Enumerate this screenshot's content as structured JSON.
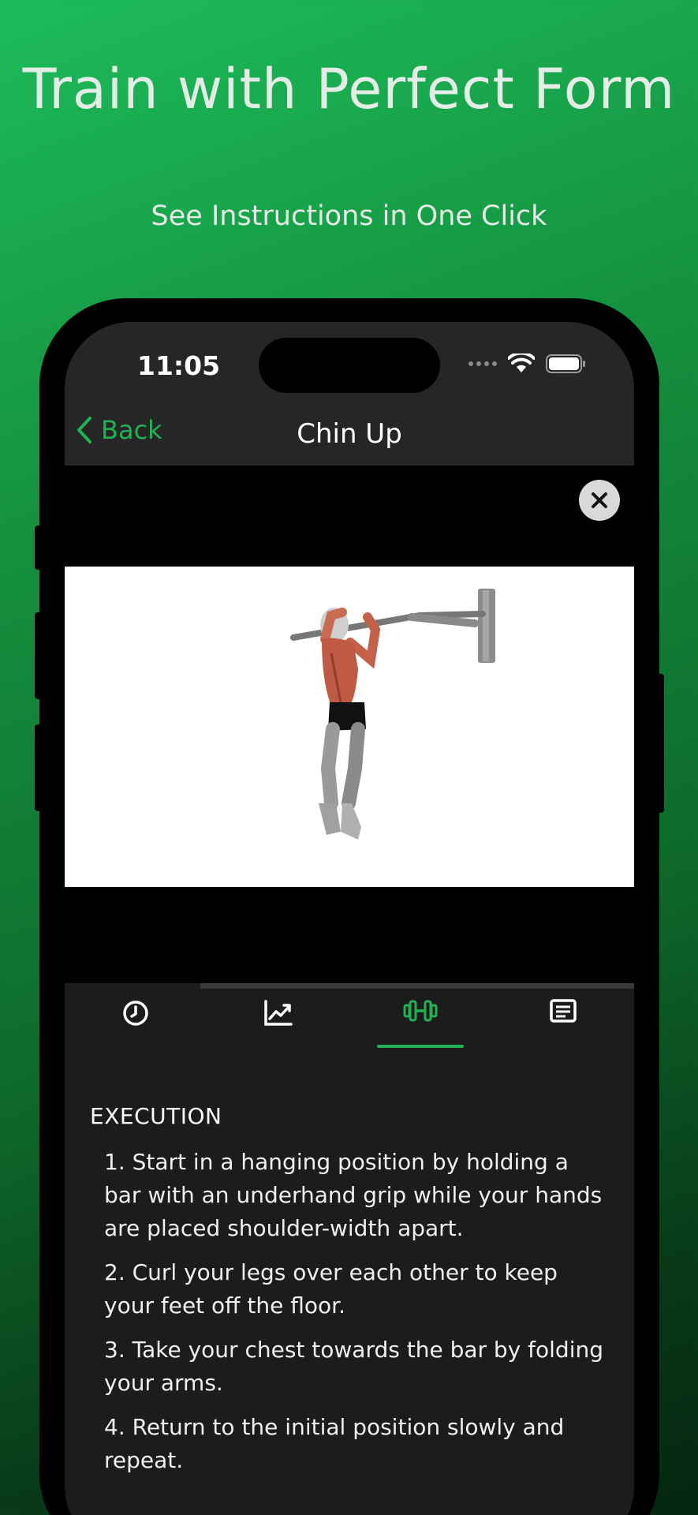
{
  "promo": {
    "headline": "Train with Perfect Form",
    "subheadline": "See Instructions in One Click"
  },
  "status_bar": {
    "time": "11:05"
  },
  "nav": {
    "back_label": "Back",
    "title": "Chin Up"
  },
  "tabs": [
    {
      "icon": "clock-icon",
      "active": false
    },
    {
      "icon": "chart-icon",
      "active": false
    },
    {
      "icon": "dumbbell-icon",
      "active": true
    },
    {
      "icon": "notes-icon",
      "active": false
    }
  ],
  "instructions": {
    "section_title": "EXECUTION",
    "steps": [
      "1. Start in a hanging position by holding a bar with an underhand grip while your hands are placed shoulder-width apart.",
      "2. Curl your legs over each other to keep your feet off the floor.",
      "3. Take your chest towards the bar by folding your arms.",
      "4. Return to the initial position slowly and repeat."
    ]
  },
  "colors": {
    "accent": "#22b255",
    "background_top": "#1dbb5c",
    "background_bottom": "#052510",
    "surface": "#1c1c1c"
  }
}
